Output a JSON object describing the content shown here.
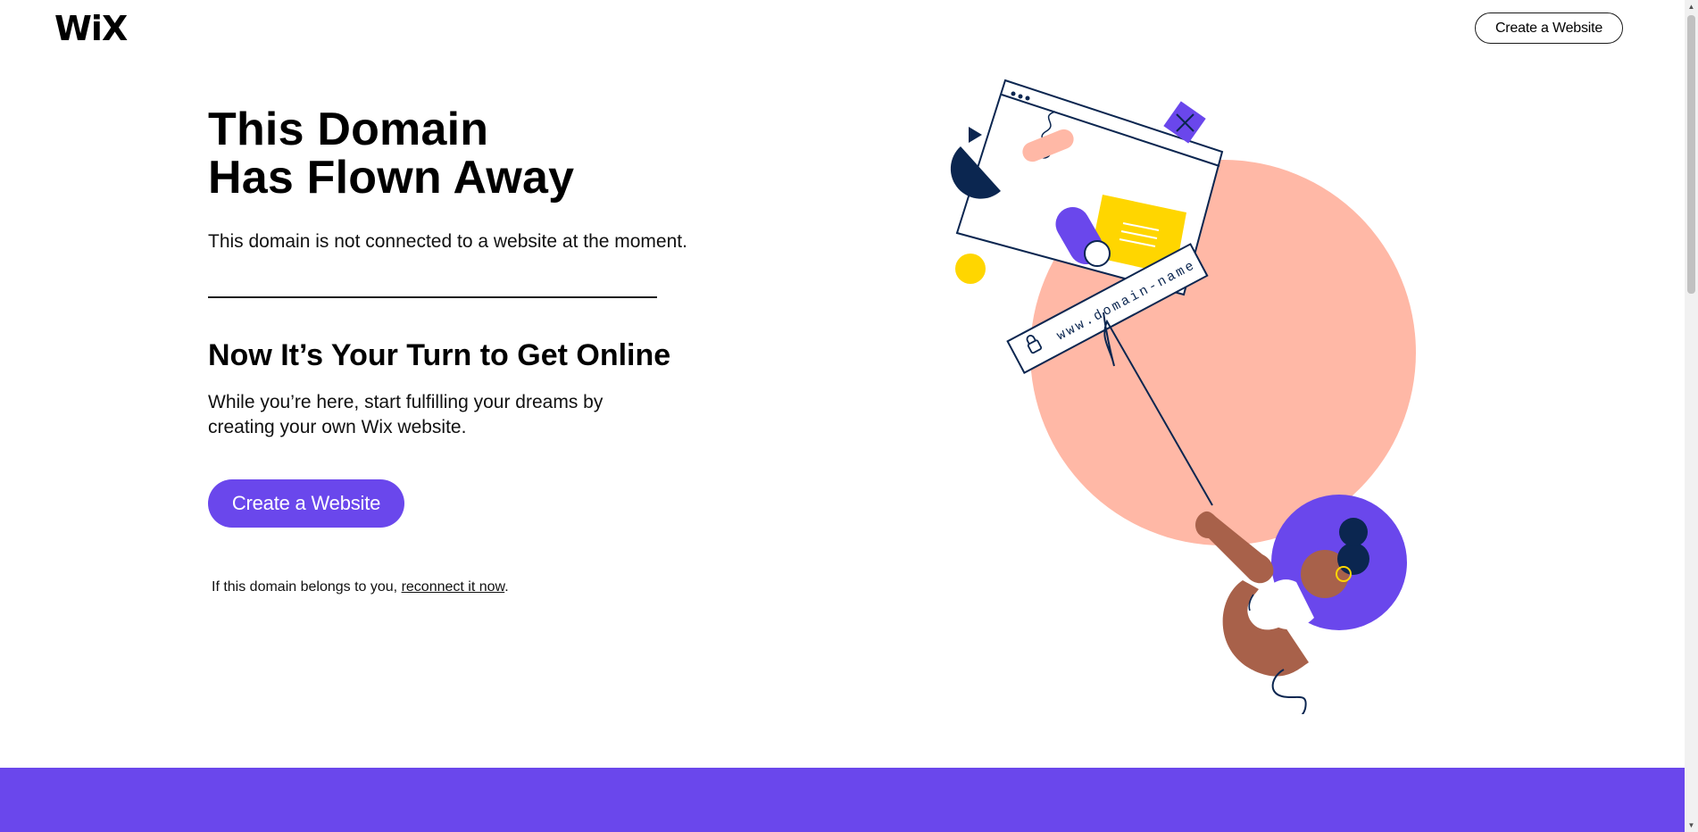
{
  "header": {
    "logo_text": "WiX",
    "create_button_label": "Create a Website"
  },
  "main": {
    "title_line1": "This Domain",
    "title_line2": "Has Flown Away",
    "subtitle": "This domain is not connected to a website at the moment.",
    "heading": "Now It’s Your Turn to Get Online",
    "paragraph_line1": "While you’re here, start fulfilling your dreams by",
    "paragraph_line2": "creating your own Wix website.",
    "cta_label": "Create a Website",
    "note_prefix": "If this domain belongs to you,",
    "note_link": "reconnect it now",
    "note_suffix": "."
  },
  "illustration": {
    "domain_bar_text": "www.domain-name",
    "icon": "lock-icon"
  },
  "colors": {
    "accent": "#6a47ec",
    "peach": "#ffb8a6",
    "yellow": "#ffd600",
    "navy": "#0b2650",
    "skin": "#a8614a"
  }
}
